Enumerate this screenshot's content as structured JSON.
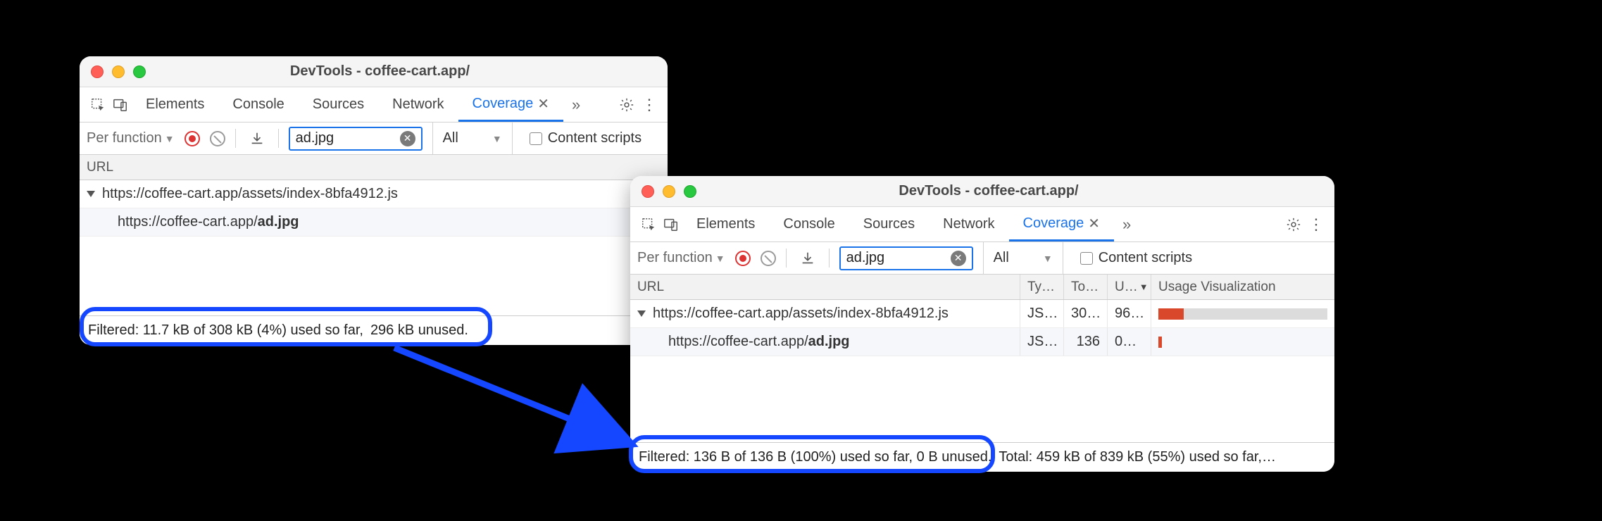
{
  "window1": {
    "title": "DevTools - coffee-cart.app/",
    "tabs": [
      "Elements",
      "Console",
      "Sources",
      "Network",
      "Coverage"
    ],
    "activeTab": "Coverage",
    "toolbar": {
      "granularity": "Per function",
      "filter_value": "ad.jpg",
      "scope": "All",
      "content_scripts_label": "Content scripts"
    },
    "grid": {
      "headers": {
        "url": "URL"
      }
    },
    "rows": [
      {
        "url_pre": "https://coffee-cart.app/assets/index-8bfa4912.js",
        "bold": null,
        "indent": 0,
        "expandable": true
      },
      {
        "url_pre": "https://coffee-cart.app/",
        "bold": "ad.jpg",
        "indent": 1,
        "expandable": false
      }
    ],
    "status_left": "Filtered: 11.7 kB of 308 kB (4%) used so far,",
    "status_right": "296 kB unused."
  },
  "window2": {
    "title": "DevTools - coffee-cart.app/",
    "tabs": [
      "Elements",
      "Console",
      "Sources",
      "Network",
      "Coverage"
    ],
    "activeTab": "Coverage",
    "toolbar": {
      "granularity": "Per function",
      "filter_value": "ad.jpg",
      "scope": "All",
      "content_scripts_label": "Content scripts"
    },
    "grid": {
      "headers": {
        "url": "URL",
        "type": "Ty…",
        "total": "To…",
        "unused": "U…",
        "usage": "Usage Visualization"
      }
    },
    "rows": [
      {
        "url_pre": "https://coffee-cart.app/assets/index-8bfa4912.js",
        "bold": null,
        "indent": 0,
        "expandable": true,
        "type": "JS…",
        "total": "30…",
        "unused": "96…",
        "used_ratio": 0.15
      },
      {
        "url_pre": "https://coffee-cart.app/",
        "bold": "ad.jpg",
        "indent": 1,
        "expandable": false,
        "type": "JS…",
        "total": "136",
        "unused": "0…",
        "used_ratio": 0.02
      }
    ],
    "status_left": "Filtered: 136 B of 136 B (100%) used so far, 0 B unused.",
    "status_right": "Total: 459 kB of 839 kB (55%) used so far,…"
  }
}
